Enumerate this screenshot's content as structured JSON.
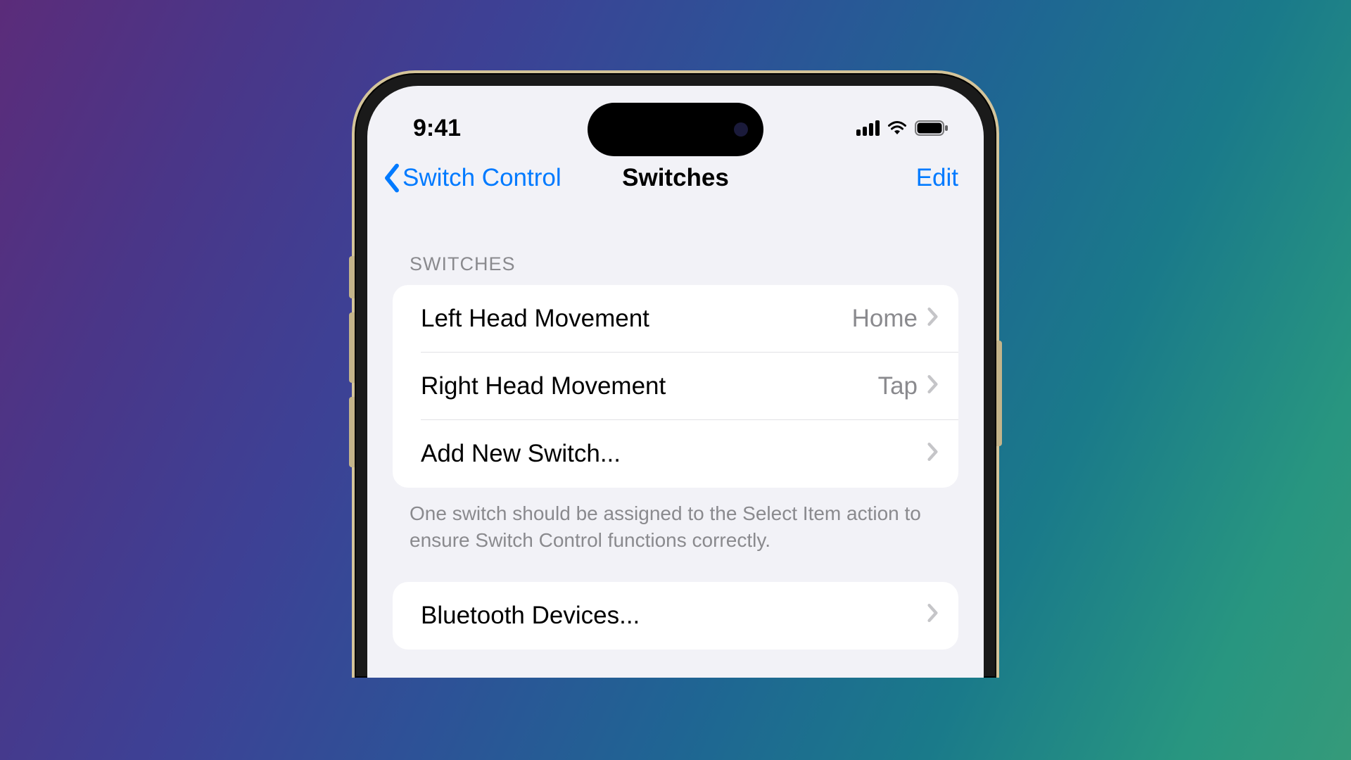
{
  "status_bar": {
    "time": "9:41"
  },
  "nav": {
    "back_label": "Switch Control",
    "title": "Switches",
    "edit_label": "Edit"
  },
  "sections": {
    "switches": {
      "header": "SWITCHES",
      "rows": [
        {
          "label": "Left Head Movement",
          "value": "Home"
        },
        {
          "label": "Right Head Movement",
          "value": "Tap"
        },
        {
          "label": "Add New Switch...",
          "value": ""
        }
      ],
      "footer": "One switch should be assigned to the Select Item action to ensure Switch Control functions correctly."
    },
    "bluetooth": {
      "rows": [
        {
          "label": "Bluetooth Devices...",
          "value": ""
        }
      ]
    }
  }
}
